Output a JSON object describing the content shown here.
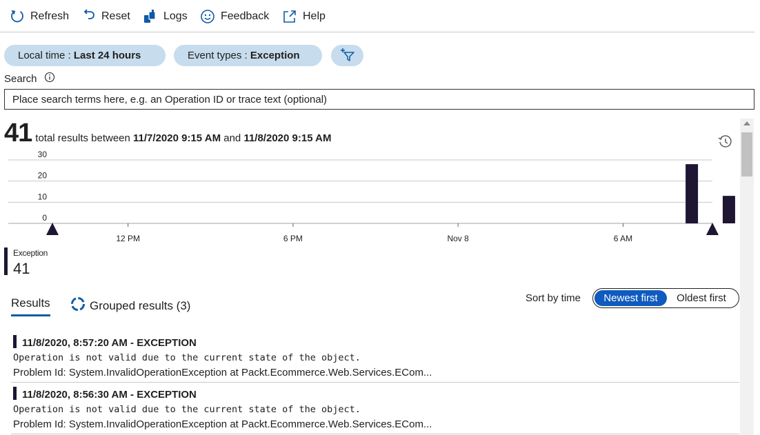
{
  "toolbar": {
    "refresh": "Refresh",
    "reset": "Reset",
    "logs": "Logs",
    "feedback": "Feedback",
    "help": "Help"
  },
  "filters": {
    "time_prefix": "Local time : ",
    "time_value": "Last 24 hours",
    "events_prefix": "Event types : ",
    "events_value": "Exception",
    "add_filter_icon": "add-filter-icon"
  },
  "search": {
    "label": "Search",
    "placeholder": "Place search terms here, e.g. an Operation ID or trace text (optional)",
    "value": ""
  },
  "summary": {
    "count": "41",
    "text_prefix": "total results between ",
    "start": "11/7/2020 9:15 AM",
    "conj": " and ",
    "end": "11/8/2020 9:15 AM"
  },
  "chart_data": {
    "type": "bar",
    "x_ticks": [
      "12 PM",
      "6 PM",
      "Nov 8",
      "6 AM"
    ],
    "y_ticks": [
      0,
      10,
      20,
      30
    ],
    "ylim": [
      0,
      30
    ],
    "x_range_hours": [
      0,
      24
    ],
    "tick_hours": [
      2.75,
      8.75,
      14.75,
      20.75
    ],
    "bars": [
      {
        "hour": 23.25,
        "value": 28
      },
      {
        "hour": 24.6,
        "value": 13
      }
    ],
    "grid": true,
    "bar_color": "#1e1633"
  },
  "legend": {
    "name": "Exception",
    "count": "41"
  },
  "tabs": {
    "results": "Results",
    "grouped": "Grouped results (3)"
  },
  "sort": {
    "label": "Sort by time",
    "newest": "Newest first",
    "oldest": "Oldest first",
    "selected": "newest"
  },
  "results": [
    {
      "title": "11/8/2020, 8:57:20 AM - EXCEPTION",
      "message": "Operation is not valid due to the current state of the object.",
      "problem": "Problem Id: System.InvalidOperationException at Packt.Ecommerce.Web.Services.ECom..."
    },
    {
      "title": "11/8/2020, 8:56:30 AM - EXCEPTION",
      "message": "Operation is not valid due to the current state of the object.",
      "problem": "Problem Id: System.InvalidOperationException at Packt.Ecommerce.Web.Services.ECom..."
    }
  ],
  "colors": {
    "pill_bg": "#c7dcec",
    "accent": "#0f5bbf",
    "bar": "#1e1633"
  }
}
